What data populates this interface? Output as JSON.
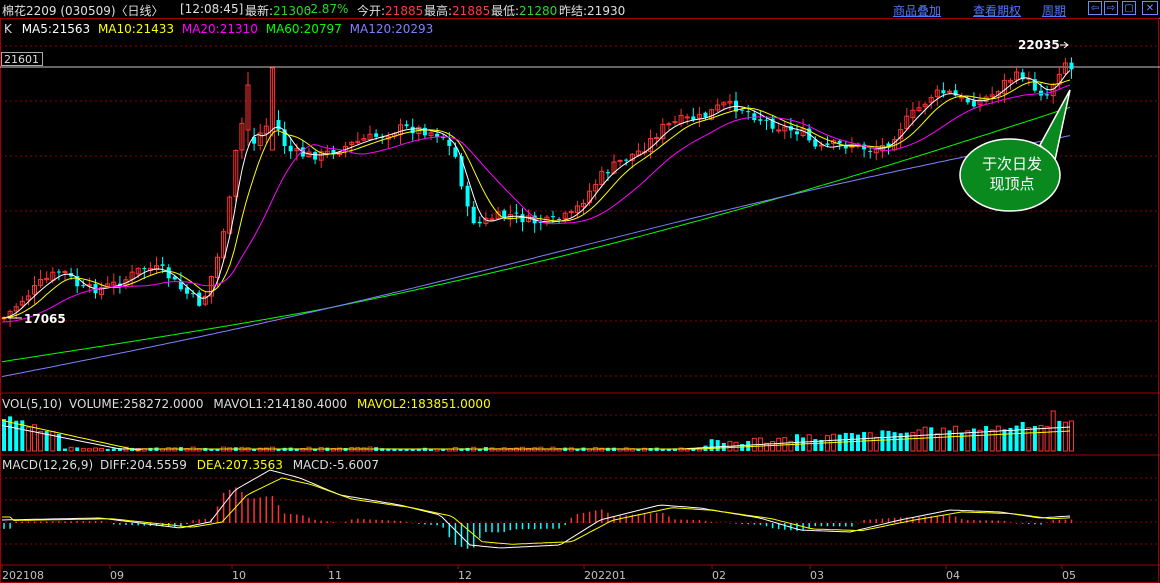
{
  "header": {
    "title": "棉花2209 (030509)〈日线〉",
    "time": "[12:08:45]",
    "latest_label": "最新:",
    "latest_value": "21300",
    "change_value": "-2.87%",
    "open_label": "今开:",
    "open_value": "21885",
    "high_label": "最高:",
    "high_value": "21885",
    "low_label": "最低:",
    "low_value": "21280",
    "prev_label": "昨结:",
    "prev_value": "21930",
    "menu": [
      "商品叠加",
      "查看期权",
      "周期"
    ],
    "buttons": [
      "⇦",
      "⇨",
      "▢"
    ]
  },
  "main_legend": {
    "k": "K",
    "ma5": "MA5:21563",
    "ma10": "MA10:21433",
    "ma20": "MA20:21310",
    "ma60": "MA60:20797",
    "ma120": "MA120:20293"
  },
  "price_box": "21601",
  "high_marker": "22035",
  "low_marker": "17065",
  "annotation": {
    "line1": "于次日发",
    "line2": "现顶点"
  },
  "volume_legend": {
    "name": "VOL(5,10)",
    "volume": "VOLUME:258272.0000",
    "mavol1": "MAVOL1:214180.4000",
    "mavol2": "MAVOL2:183851.0000"
  },
  "macd_legend": {
    "name": "MACD(12,26,9)",
    "diff": "DIFF:204.5559",
    "dea": "DEA:207.3563",
    "macd": "MACD:-5.6007"
  },
  "dates": [
    "202108",
    "09",
    "10",
    "11",
    "12",
    "202201",
    "02",
    "03",
    "04",
    "05"
  ],
  "colors": {
    "up": "#ff3232",
    "down": "#00ffff",
    "ma5": "#ffffff",
    "ma10": "#ffff00",
    "ma20": "#ff00ff",
    "ma60": "#00ff00",
    "ma120": "#8080ff",
    "annotation_bg": "#0a8a1e"
  },
  "chart_data": {
    "type": "candlestick",
    "price_extremes": {
      "high": 22035,
      "low": 17065,
      "last": 21300
    },
    "moving_averages": {
      "MA5": 21563,
      "MA10": 21433,
      "MA20": 21310,
      "MA60": 20797,
      "MA120": 20293
    },
    "volume": {
      "VOLUME": 258272,
      "MAVOL1": 214180.4,
      "MAVOL2": 183851
    },
    "macd": {
      "DIFF": 204.5559,
      "DEA": 207.3563,
      "MACD": -5.6007
    }
  }
}
